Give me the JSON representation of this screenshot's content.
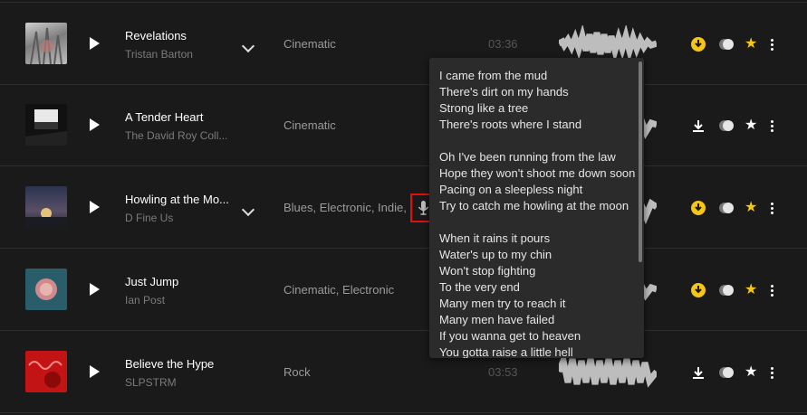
{
  "tracks": [
    {
      "title": "Revelations",
      "artist": "Tristan Barton",
      "genre": "Cinematic",
      "duration": "03:36",
      "download": "yellow",
      "favorite": "yellow"
    },
    {
      "title": "A Tender Heart",
      "artist": "The David Roy Coll...",
      "genre": "Cinematic",
      "duration": "",
      "download": "white",
      "favorite": "white"
    },
    {
      "title": "Howling at the Mo...",
      "artist": "D Fine Us",
      "genre": "Blues, Electronic, Indie,",
      "duration": "",
      "download": "yellow",
      "favorite": "yellow"
    },
    {
      "title": "Just Jump",
      "artist": "Ian Post",
      "genre": "Cinematic, Electronic",
      "duration": "",
      "download": "yellow",
      "favorite": "yellow"
    },
    {
      "title": "Believe the Hype",
      "artist": "SLPSTRM",
      "genre": "Rock",
      "duration": "03:53",
      "download": "white",
      "favorite": "white"
    }
  ],
  "lyrics": {
    "lines": [
      "I came from the mud",
      "There's dirt on my hands",
      "Strong like a tree",
      "There's roots where I stand",
      "",
      "Oh I've been running from the law",
      "Hope they won't shoot me down soon",
      "Pacing on a sleepless night",
      "Try to catch me howling at the moon",
      "",
      "When it rains it pours",
      "Water's up to my chin",
      "Won't stop fighting",
      "To the very end",
      "Many men try to reach it",
      "Many men have failed",
      "If you wanna get to heaven",
      "You gotta raise a little hell"
    ]
  },
  "colors": {
    "accent": "#f5c518",
    "background": "#1a1a1a",
    "popup": "#2b2b2b",
    "highlight": "#e01010"
  },
  "icons": {
    "play": "play-icon",
    "expand": "chevron-down-icon",
    "lyrics": "microphone-icon",
    "download": "download-icon",
    "toggle": "toggle-icon",
    "favorite": "star-icon",
    "more": "more-vertical-icon"
  }
}
